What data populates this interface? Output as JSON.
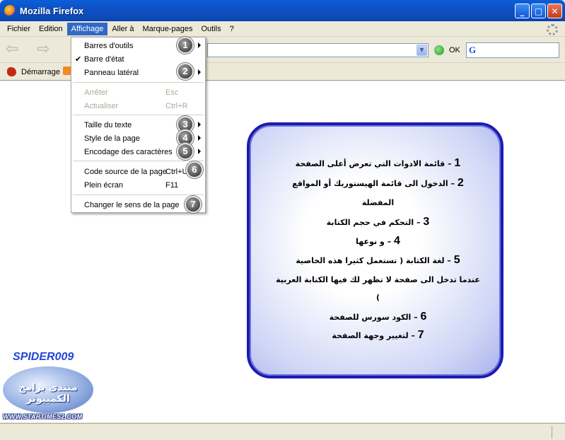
{
  "window": {
    "title": "Mozilla Firefox",
    "controls": [
      "_",
      "□",
      "✕"
    ]
  },
  "menubar": {
    "items": [
      "Fichier",
      "Edition",
      "Affichage",
      "Aller à",
      "Marque-pages",
      "Outils",
      "?"
    ],
    "active_index": 2
  },
  "navbar": {
    "url_value": "",
    "go_label": "OK",
    "search_engine_glyph": "G"
  },
  "bookmarks": {
    "items": [
      "Démarrage"
    ]
  },
  "dropdown": {
    "items": [
      {
        "label": "Barres d'outils",
        "shortcut": "",
        "submenu": true,
        "checked": false,
        "disabled": false,
        "badge": "1"
      },
      {
        "label": "Barre d'état",
        "shortcut": "",
        "submenu": false,
        "checked": true,
        "disabled": false,
        "badge": ""
      },
      {
        "label": "Panneau latéral",
        "shortcut": "",
        "submenu": true,
        "checked": false,
        "disabled": false,
        "badge": "2"
      },
      {
        "label": "Arrêter",
        "shortcut": "Esc",
        "submenu": false,
        "checked": false,
        "disabled": true,
        "badge": ""
      },
      {
        "label": "Actualiser",
        "shortcut": "Ctrl+R",
        "submenu": false,
        "checked": false,
        "disabled": true,
        "badge": ""
      },
      {
        "label": "Taille du texte",
        "shortcut": "",
        "submenu": true,
        "checked": false,
        "disabled": false,
        "badge": "3"
      },
      {
        "label": "Style de la page",
        "shortcut": "",
        "submenu": true,
        "checked": false,
        "disabled": false,
        "badge": "4"
      },
      {
        "label": "Encodage des caractères",
        "shortcut": "",
        "submenu": true,
        "checked": false,
        "disabled": false,
        "badge": "5"
      },
      {
        "label": "Code source de la page",
        "shortcut": "Ctrl+U",
        "submenu": false,
        "checked": false,
        "disabled": false,
        "badge": "6"
      },
      {
        "label": "Plein écran",
        "shortcut": "F11",
        "submenu": false,
        "checked": false,
        "disabled": false,
        "badge": ""
      },
      {
        "label": "Changer le sens de la page",
        "shortcut": "",
        "submenu": false,
        "checked": false,
        "disabled": false,
        "badge": "7"
      }
    ]
  },
  "panel": {
    "lines": [
      {
        "num": "1",
        "text": "– قائمة الادوات التي تعرض أعلى الصفحة"
      },
      {
        "num": "2",
        "text": "– الدخول الى قائمة الهيستوريك أو المواقع"
      },
      {
        "num": "",
        "text": "المفضلة"
      },
      {
        "num": "3",
        "text": "– التحكم في حجم الكتابة"
      },
      {
        "num": "4",
        "text": "– و نوعها"
      },
      {
        "num": "5",
        "text": "– لغة الكتابة ( تستعمل كثيرا هذه الخاصية"
      },
      {
        "num": "",
        "text": "عندما تدخل الى صفحة لا تظهر لك فيها  الكتابة العربية"
      },
      {
        "num": "",
        "text": ")"
      },
      {
        "num": "6",
        "text": "– الكود سورس للصفحة"
      },
      {
        "num": "7",
        "text": "– لتغيير وجهة الصفحة"
      }
    ]
  },
  "watermark": {
    "title": "SPIDER009",
    "arabic": "منتدى برامج الكمبيوتر",
    "url": "WWW.STARTIMES2.COM"
  }
}
